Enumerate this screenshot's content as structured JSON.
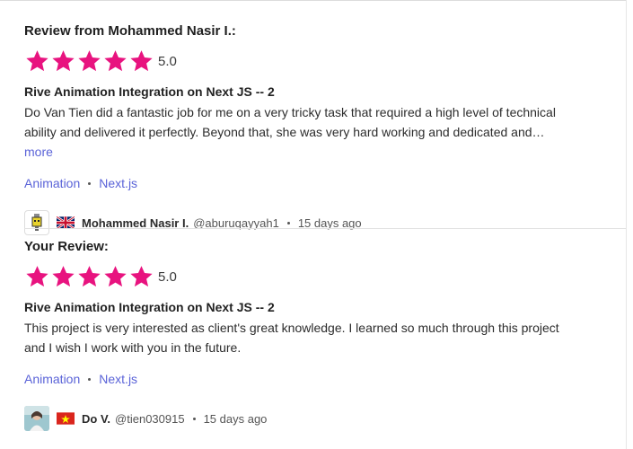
{
  "reviews": [
    {
      "heading": "Review from Mohammed Nasir I.:",
      "rating": 5,
      "rating_label": "5.0",
      "title": "Rive Animation Integration on Next JS -- 2",
      "body": "Do Van Tien did a fantastic job for me on a very tricky task that required a high level of technical ability and delivered it perfectly. Beyond that, she was very hard working and dedicated and…",
      "more_label": "more",
      "tags": [
        "Animation",
        "Next.js"
      ],
      "author": {
        "name": "Mohammed Nasir I.",
        "handle": "@aburuqayyah1",
        "time": "15 days ago",
        "flag": "uk-flag-icon"
      }
    },
    {
      "heading": "Your Review:",
      "rating": 5,
      "rating_label": "5.0",
      "title": "Rive Animation Integration on Next JS -- 2",
      "body": "This project is very interested as client's great knowledge. I learned so much through this project and I wish I work with you in the future.",
      "tags": [
        "Animation",
        "Next.js"
      ],
      "author": {
        "name": "Do V.",
        "handle": "@tien030915",
        "time": "15 days ago",
        "flag": "vietnam-flag-icon"
      }
    }
  ],
  "colors": {
    "star": "#e8137f",
    "link": "#5a63d8"
  }
}
